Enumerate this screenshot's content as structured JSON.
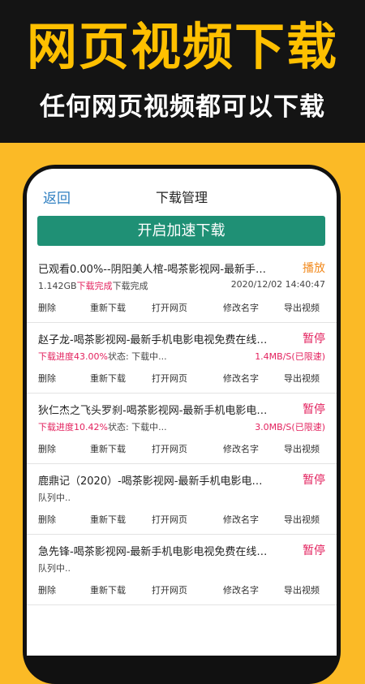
{
  "promo": {
    "title": "网页视频下载",
    "subtitle": "任何网页视频都可以下载"
  },
  "header": {
    "back_label": "返回",
    "title": "下载管理"
  },
  "accelerate_button": "开启加速下载",
  "colors": {
    "background_yellow": "#fbba26",
    "banner_black": "#141414",
    "accent_green": "#1f9075",
    "link_blue": "#2f7fc1",
    "action_orange": "#f28a1e",
    "pause_pink": "#e3225e"
  },
  "downloads": [
    {
      "title": "已观看0.00%--阴阳美人棺-喝茶影视网-最新手…",
      "action": "播放",
      "status": {
        "size": "1.142GB",
        "highlight": "下载完成",
        "text": "下载完成",
        "right": "2020/12/02 14:40:47"
      },
      "buttons": [
        "删除",
        "重新下载",
        "打开网页",
        "修改名字",
        "导出视频"
      ]
    },
    {
      "title": "赵子龙-喝茶影视网-最新手机电影电视免费在线…",
      "action": "暂停",
      "status": {
        "size": "",
        "highlight": "下载进度43.00%",
        "text": "状态: 下载中...",
        "right": "1.4MB/S(已限速)"
      },
      "buttons": [
        "删除",
        "重新下载",
        "打开网页",
        "修改名字",
        "导出视频"
      ]
    },
    {
      "title": "狄仁杰之飞头罗刹-喝茶影视网-最新手机电影电…",
      "action": "暂停",
      "status": {
        "size": "",
        "highlight": "下载进度10.42%",
        "text": "状态: 下载中...",
        "right": "3.0MB/S(已限速)"
      },
      "buttons": [
        "删除",
        "重新下载",
        "打开网页",
        "修改名字",
        "导出视频"
      ]
    },
    {
      "title": "鹿鼎记（2020）-喝茶影视网-最新手机电影电…",
      "action": "暂停",
      "status": {
        "size": "",
        "highlight": "",
        "text": "队列中..",
        "right": ""
      },
      "buttons": [
        "删除",
        "重新下载",
        "打开网页",
        "修改名字",
        "导出视频"
      ]
    },
    {
      "title": "急先锋-喝茶影视网-最新手机电影电视免费在线…",
      "action": "暂停",
      "status": {
        "size": "",
        "highlight": "",
        "text": "队列中..",
        "right": ""
      },
      "buttons": [
        "删除",
        "重新下载",
        "打开网页",
        "修改名字",
        "导出视频"
      ]
    }
  ]
}
